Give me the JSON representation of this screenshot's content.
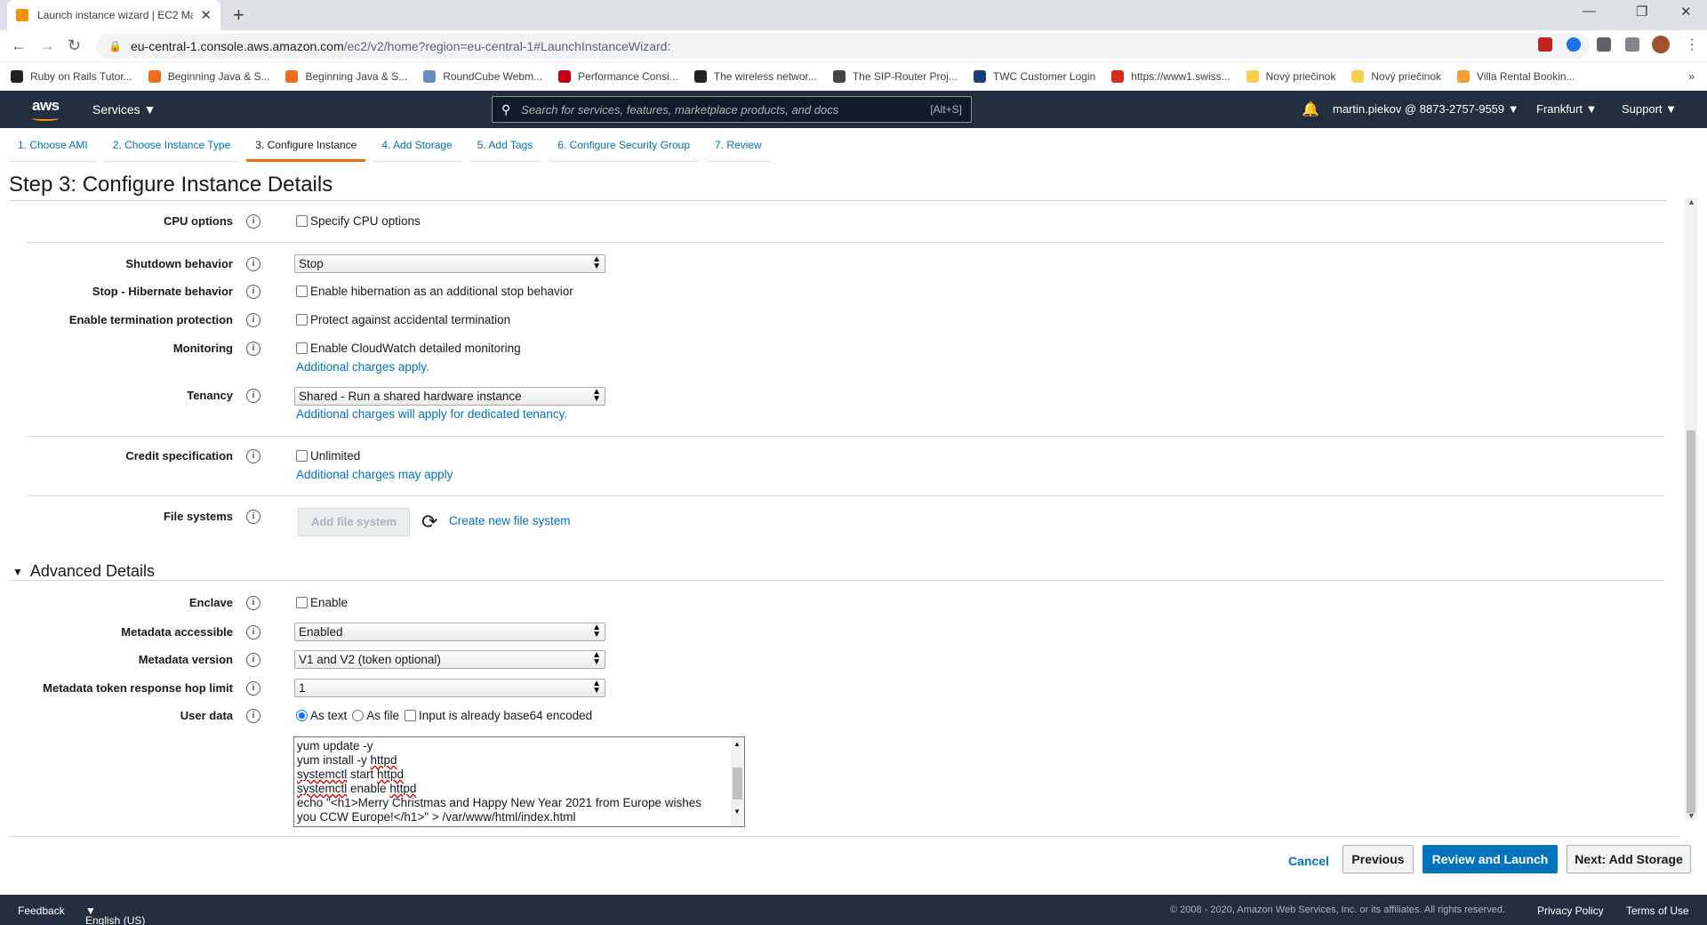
{
  "browser": {
    "tab_title": "Launch instance wizard | EC2 Ma",
    "url_host": "eu-central-1.console.aws.amazon.com",
    "url_path": "/ec2/v2/home?region=eu-central-1#LaunchInstanceWizard:",
    "bookmarks": [
      {
        "label": "Ruby on Rails Tutor...",
        "color": "#222222"
      },
      {
        "label": "Beginning Java & S...",
        "color": "#f26b21"
      },
      {
        "label": "Beginning Java & S...",
        "color": "#f26b21"
      },
      {
        "label": "RoundCube Webm...",
        "color": "#6b8bbf"
      },
      {
        "label": "Performance Consi...",
        "color": "#c0001a"
      },
      {
        "label": "The wireless networ...",
        "color": "#222222"
      },
      {
        "label": "The SIP-Router Proj...",
        "color": "#444444"
      },
      {
        "label": "TWC Customer Login",
        "color": "#1a3d7c"
      },
      {
        "label": "https://www1.swiss...",
        "color": "#d52b1e"
      },
      {
        "label": "Nový priečinok",
        "color": "#f6d04d"
      },
      {
        "label": "Nový priečinok",
        "color": "#f6d04d"
      },
      {
        "label": "Villa Rental Bookin...",
        "color": "#f0a030"
      }
    ],
    "bookmarks_overflow": "»"
  },
  "aws_nav": {
    "logo": "aws",
    "services": "Services",
    "search_placeholder": "Search for services, features, marketplace products, and docs",
    "search_shortcut": "[Alt+S]",
    "account": "martin.piekov @ 8873-2757-9559",
    "region": "Frankfurt",
    "support": "Support"
  },
  "wizard_steps": [
    {
      "label": "1. Choose AMI"
    },
    {
      "label": "2. Choose Instance Type"
    },
    {
      "label": "3. Configure Instance"
    },
    {
      "label": "4. Add Storage"
    },
    {
      "label": "5. Add Tags"
    },
    {
      "label": "6. Configure Security Group"
    },
    {
      "label": "7. Review"
    }
  ],
  "page_title": "Step 3: Configure Instance Details",
  "form": {
    "cpu_options": {
      "label": "CPU options",
      "checkbox": "Specify CPU options"
    },
    "shutdown": {
      "label": "Shutdown behavior",
      "value": "Stop"
    },
    "hibernate": {
      "label": "Stop - Hibernate behavior",
      "checkbox": "Enable hibernation as an additional stop behavior"
    },
    "termination": {
      "label": "Enable termination protection",
      "checkbox": "Protect against accidental termination"
    },
    "monitoring": {
      "label": "Monitoring",
      "checkbox": "Enable CloudWatch detailed monitoring",
      "link": "Additional charges apply."
    },
    "tenancy": {
      "label": "Tenancy",
      "value": "Shared - Run a shared hardware instance",
      "link": "Additional charges will apply for dedicated tenancy."
    },
    "credit": {
      "label": "Credit specification",
      "checkbox": "Unlimited",
      "link": "Additional charges may apply"
    },
    "file_systems": {
      "label": "File systems",
      "add_button": "Add file system",
      "create_link": "Create new file system"
    }
  },
  "advanced": {
    "heading": "Advanced Details",
    "enclave": {
      "label": "Enclave",
      "checkbox": "Enable"
    },
    "metadata_accessible": {
      "label": "Metadata accessible",
      "value": "Enabled"
    },
    "metadata_version": {
      "label": "Metadata version",
      "value": "V1 and V2 (token optional)"
    },
    "hop_limit": {
      "label": "Metadata token response hop limit",
      "value": "1"
    },
    "user_data": {
      "label": "User data",
      "as_text": "As text",
      "as_file": "As file",
      "base64": "Input is already base64 encoded",
      "lines": {
        "l1a": "yum update -y",
        "l2a": "yum install -y ",
        "l2b": "httpd",
        "l3a": "systemctl",
        "l3b": " start ",
        "l3c": "httpd",
        "l4a": "systemctl",
        "l4b": " enable ",
        "l4c": "httpd",
        "l5": "echo \"<h1>Merry Christmas and Happy New Year 2021 from Europe wishes",
        "l6": "you CCW Europe!</h1>\" > /var/www/html/index.html"
      }
    }
  },
  "actions": {
    "cancel": "Cancel",
    "previous": "Previous",
    "review": "Review and Launch",
    "next": "Next: Add Storage"
  },
  "footer": {
    "feedback": "Feedback",
    "language": "English (US)",
    "copyright": "© 2008 - 2020, Amazon Web Services, Inc. or its affiliates. All rights reserved.",
    "privacy": "Privacy Policy",
    "terms": "Terms of Use"
  },
  "colors": {
    "aws_nav": "#232f3e",
    "accent": "#ec7211",
    "link": "#0073bb",
    "primary_button": "#0073bb"
  }
}
